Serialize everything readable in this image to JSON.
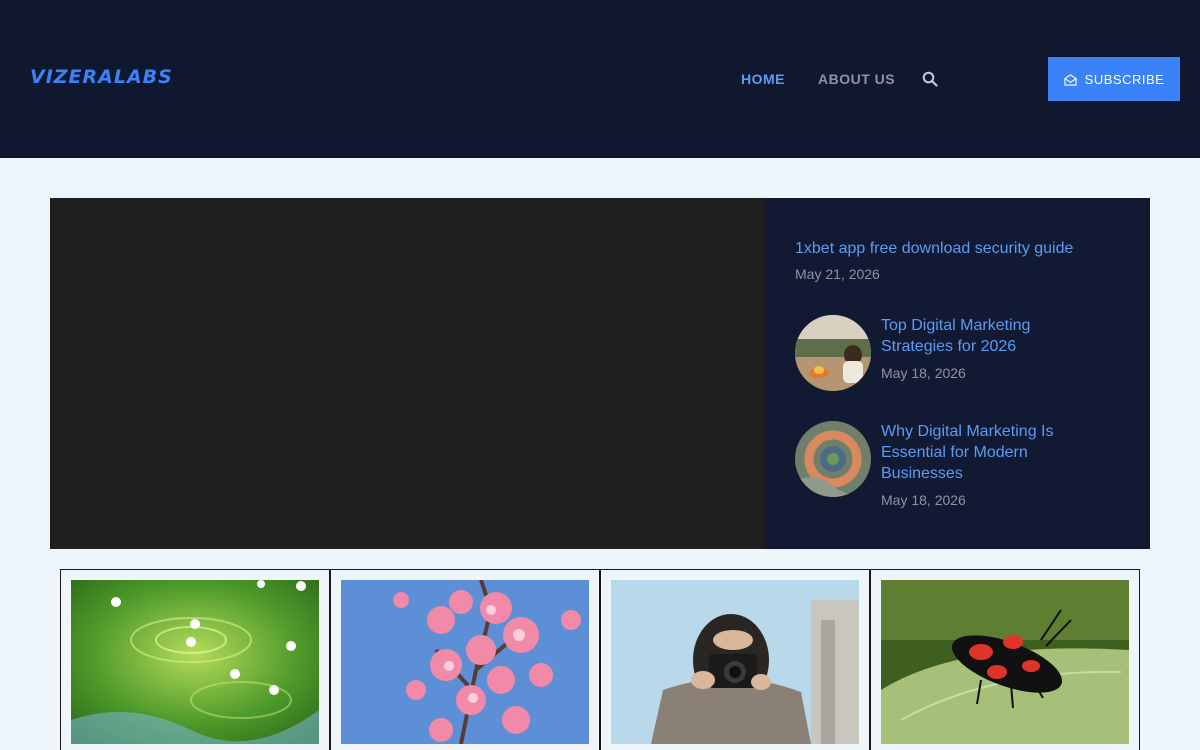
{
  "header": {
    "logo_text": "VIZERALABS",
    "nav": {
      "home": "HOME",
      "about": "ABOUT US"
    },
    "subscribe_label": "SUBSCRIBE"
  },
  "hero": {
    "featured": {
      "title": "1xbet app free download security guide",
      "date": "May 21, 2026"
    },
    "posts": [
      {
        "title": "Top Digital Marketing Strategies for 2026",
        "date": "May 18, 2026"
      },
      {
        "title": "Why Digital Marketing Is Essential for Modern Businesses",
        "date": "May 18, 2026"
      }
    ]
  },
  "cards": [
    {
      "image": "green-water-flowers-photo"
    },
    {
      "image": "pink-blossoms-sky-photo"
    },
    {
      "image": "woman-camera-photo"
    },
    {
      "image": "red-black-bug-leaf-photo"
    }
  ],
  "colors": {
    "header_bg": "#101830",
    "accent": "#3b82f6",
    "page_bg": "#eef6fc",
    "video_bg": "#1e1e1e",
    "side_bg": "#121a33"
  }
}
